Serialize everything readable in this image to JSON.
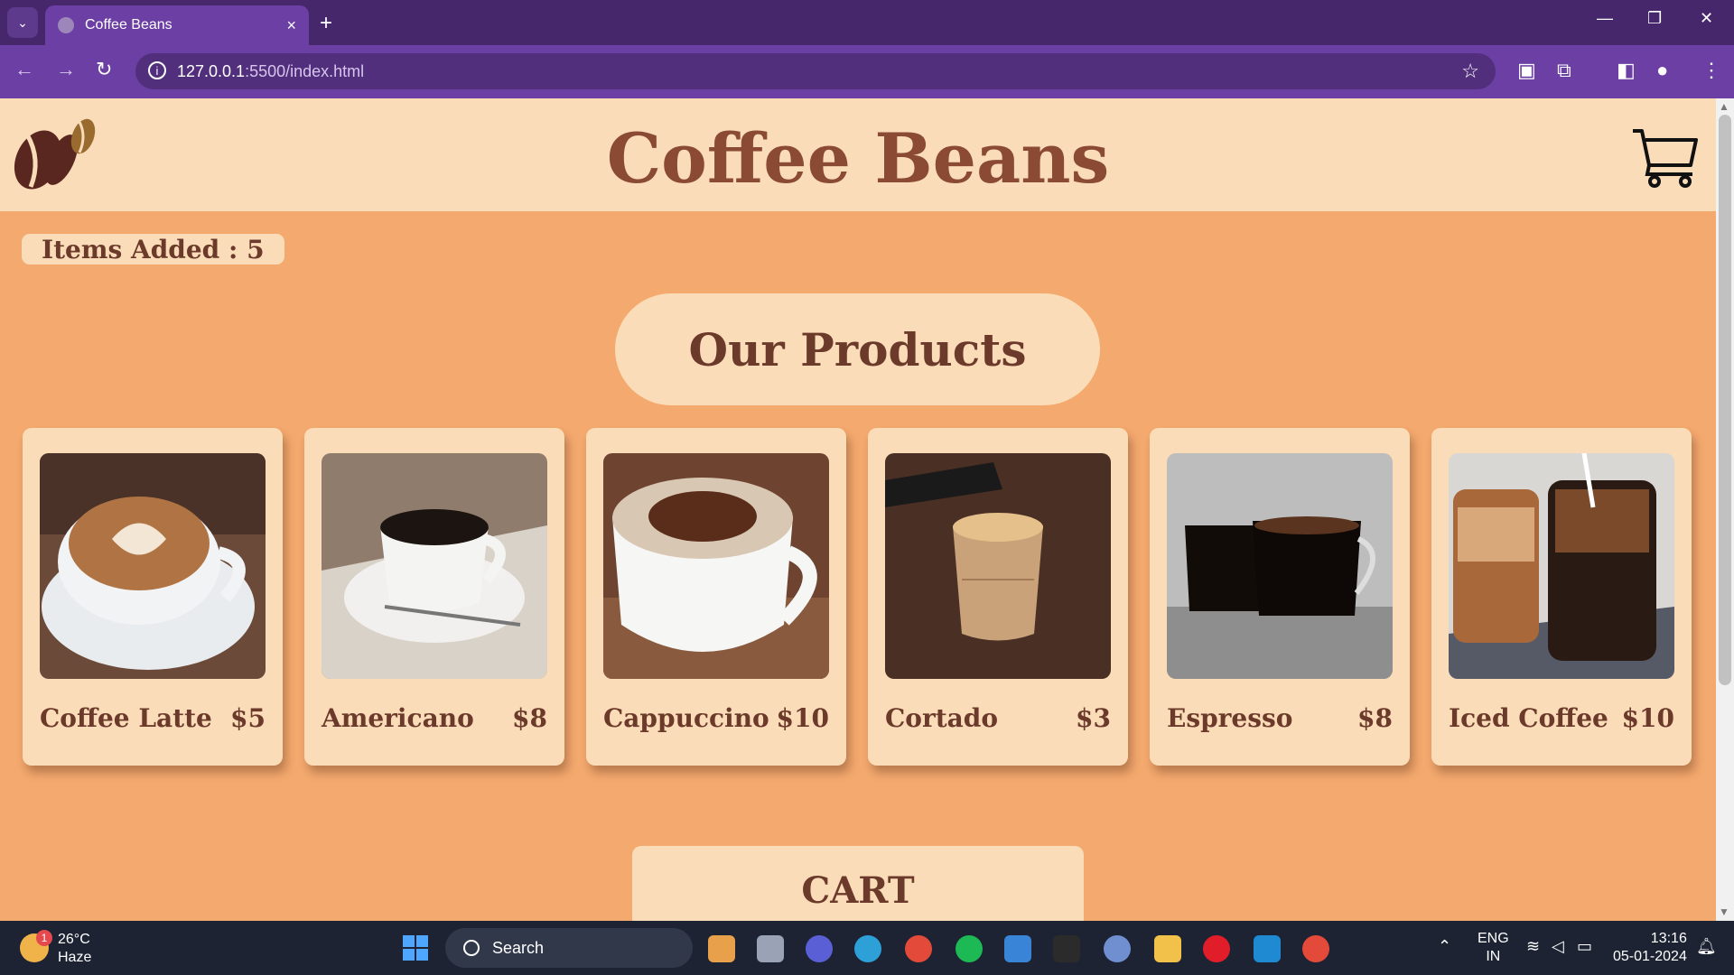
{
  "browser": {
    "tab_title": "Coffee Beans",
    "url_host": "127.0.0.1",
    "url_path": ":5500/index.html"
  },
  "site": {
    "title": "Coffee Beans",
    "items_added": "Items Added : 5",
    "products_heading": "Our Products",
    "cart_heading": "CART"
  },
  "products": [
    {
      "name": "Coffee Latte",
      "price": "$5"
    },
    {
      "name": "Americano",
      "price": "$8"
    },
    {
      "name": "Cappuccino",
      "price": "$10"
    },
    {
      "name": "Cortado",
      "price": "$3"
    },
    {
      "name": "Espresso",
      "price": "$8"
    },
    {
      "name": "Iced Coffee",
      "price": "$10"
    }
  ],
  "taskbar": {
    "weather_badge": "1",
    "temperature": "26°C",
    "condition": "Haze",
    "search_label": "Search",
    "lang_top": "ENG",
    "lang_bottom": "IN",
    "time": "13:16",
    "date": "05-01-2024"
  },
  "colors": {
    "brand_brown": "#8a4a33",
    "page_bg": "#f4a96e",
    "card_bg": "#fbdcb8",
    "browser_purple": "#6b3fa3"
  }
}
